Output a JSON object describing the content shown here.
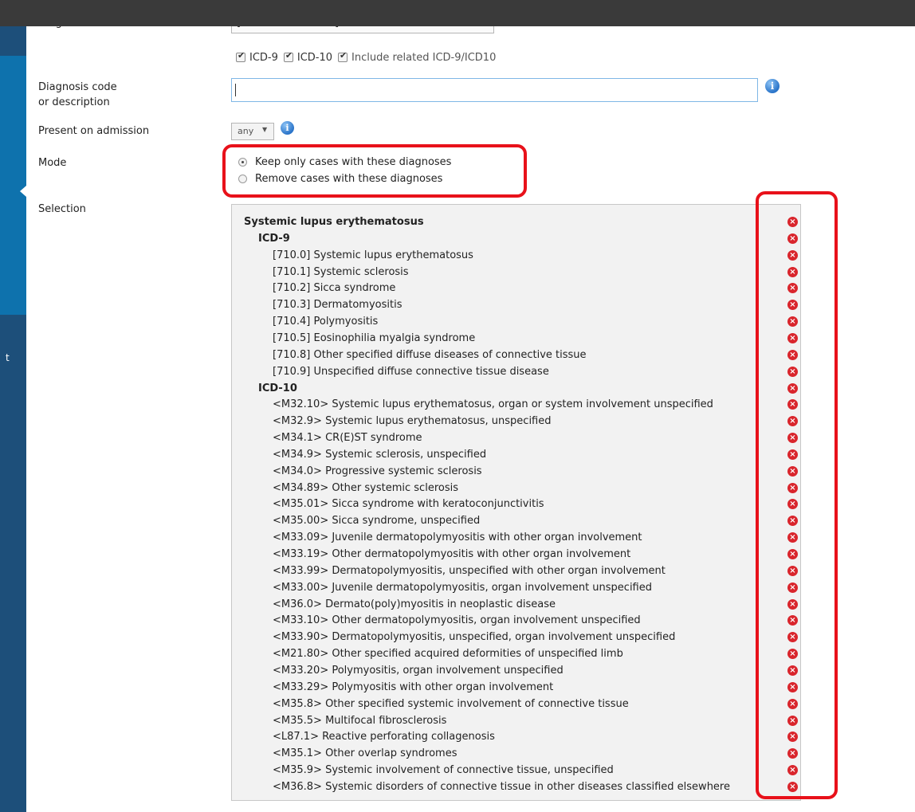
{
  "sidebar": {
    "glyph": "t"
  },
  "form": {
    "diagnosis_source_label": "Diagnosis source",
    "diagnosis_source_value": "[Search all sources]",
    "icd9_label": "ICD-9",
    "icd10_label": "ICD-10",
    "related_label": "Include related ICD-9/ICD10",
    "icd9_checked": true,
    "icd10_checked": true,
    "related_checked": true,
    "diag_label_line1": "Diagnosis code",
    "diag_label_line2": "or description",
    "diag_value": "",
    "poa_label": "Present on admission",
    "poa_value": "any",
    "mode_label": "Mode",
    "mode_keep": "Keep only cases with these diagnoses",
    "mode_remove": "Remove cases with these diagnoses",
    "mode_selected": "keep",
    "selection_label": "Selection"
  },
  "info_icon": "info-icon",
  "remove_icon": "remove-circle-icon",
  "highlight_color": "#e8111a",
  "selection": [
    {
      "level": 0,
      "text": "Systemic lupus erythematosus"
    },
    {
      "level": 1,
      "text": "ICD-9"
    },
    {
      "level": 2,
      "text": "[710.0] Systemic lupus erythematosus"
    },
    {
      "level": 2,
      "text": "[710.1] Systemic sclerosis"
    },
    {
      "level": 2,
      "text": "[710.2] Sicca syndrome"
    },
    {
      "level": 2,
      "text": "[710.3] Dermatomyositis"
    },
    {
      "level": 2,
      "text": "[710.4] Polymyositis"
    },
    {
      "level": 2,
      "text": "[710.5] Eosinophilia myalgia syndrome"
    },
    {
      "level": 2,
      "text": "[710.8] Other specified diffuse diseases of connective tissue"
    },
    {
      "level": 2,
      "text": "[710.9] Unspecified diffuse connective tissue disease"
    },
    {
      "level": 1,
      "text": "ICD-10"
    },
    {
      "level": 2,
      "text": "<M32.10> Systemic lupus erythematosus, organ or system involvement unspecified"
    },
    {
      "level": 2,
      "text": "<M32.9> Systemic lupus erythematosus, unspecified"
    },
    {
      "level": 2,
      "text": "<M34.1> CR(E)ST syndrome"
    },
    {
      "level": 2,
      "text": "<M34.9> Systemic sclerosis, unspecified"
    },
    {
      "level": 2,
      "text": "<M34.0> Progressive systemic sclerosis"
    },
    {
      "level": 2,
      "text": "<M34.89> Other systemic sclerosis"
    },
    {
      "level": 2,
      "text": "<M35.01> Sicca syndrome with keratoconjunctivitis"
    },
    {
      "level": 2,
      "text": "<M35.00> Sicca syndrome, unspecified"
    },
    {
      "level": 2,
      "text": "<M33.09> Juvenile dermatopolymyositis with other organ involvement"
    },
    {
      "level": 2,
      "text": "<M33.19> Other dermatopolymyositis with other organ involvement"
    },
    {
      "level": 2,
      "text": "<M33.99> Dermatopolymyositis, unspecified with other organ involvement"
    },
    {
      "level": 2,
      "text": "<M33.00> Juvenile dermatopolymyositis, organ involvement unspecified"
    },
    {
      "level": 2,
      "text": "<M36.0> Dermato(poly)myositis in neoplastic disease"
    },
    {
      "level": 2,
      "text": "<M33.10> Other dermatopolymyositis, organ involvement unspecified"
    },
    {
      "level": 2,
      "text": "<M33.90> Dermatopolymyositis, unspecified, organ involvement unspecified"
    },
    {
      "level": 2,
      "text": "<M21.80> Other specified acquired deformities of unspecified limb"
    },
    {
      "level": 2,
      "text": "<M33.20> Polymyositis, organ involvement unspecified"
    },
    {
      "level": 2,
      "text": "<M33.29> Polymyositis with other organ involvement"
    },
    {
      "level": 2,
      "text": "<M35.8> Other specified systemic involvement of connective tissue"
    },
    {
      "level": 2,
      "text": "<M35.5> Multifocal fibrosclerosis"
    },
    {
      "level": 2,
      "text": "<L87.1> Reactive perforating collagenosis"
    },
    {
      "level": 2,
      "text": "<M35.1> Other overlap syndromes"
    },
    {
      "level": 2,
      "text": "<M35.9> Systemic involvement of connective tissue, unspecified"
    },
    {
      "level": 2,
      "text": "<M36.8> Systemic disorders of connective tissue in other diseases classified elsewhere"
    }
  ]
}
